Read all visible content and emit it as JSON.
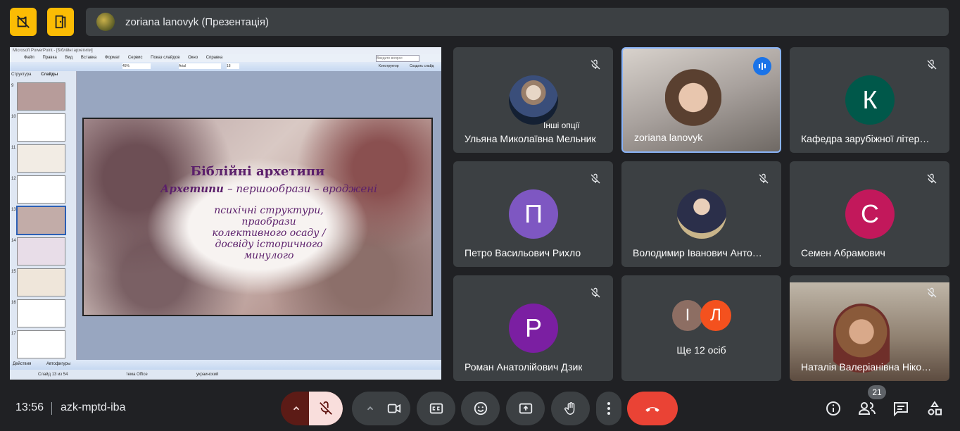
{
  "presenter": {
    "name": "zoriana lanovyk (Презентація)"
  },
  "powerpoint": {
    "title": "Microsoft PowerPoint - [Біблійні архетипи]",
    "menu": [
      "Файл",
      "Правка",
      "Вид",
      "Вставка",
      "Формат",
      "Сервис",
      "Показ слайдов",
      "Окно",
      "Справка"
    ],
    "help_placeholder": "Введите вопрос",
    "zoom": "45%",
    "font": "Arial",
    "font_size": "18",
    "designer": "Конструктор",
    "new_slide": "Создать слайд",
    "tabs": [
      "Структура",
      "Слайды"
    ],
    "thumb_numbers": [
      "9",
      "10",
      "11",
      "12",
      "13",
      "14",
      "15",
      "16",
      "17"
    ],
    "slide": {
      "title": "Біблійні архетипи",
      "term": "Архетипи",
      "body": [
        "– першообрази – вроджені",
        "психічні структури,",
        "праобрази",
        "колективного осаду /",
        "досвіду історичного",
        "минулого"
      ]
    },
    "draw_label": "Действия",
    "autoshapes": "Автофигуры",
    "status": {
      "slide": "Слайд 13 из 54",
      "theme": "тема Office",
      "lang": "украинский"
    }
  },
  "participants": [
    {
      "name": "Ульяна Миколаївна Мельник",
      "more": "Інші опції",
      "muted": true
    },
    {
      "name": "zoriana lanovyk",
      "speaking": true
    },
    {
      "name": "Кафедра зарубіжної літер…",
      "initial": "К",
      "color": "#00584a",
      "muted": true
    },
    {
      "name": "Петро Васильович Рихло",
      "initial": "П",
      "color": "#7e57c2",
      "muted": true
    },
    {
      "name": "Володимир Іванович Анто…",
      "muted": true
    },
    {
      "name": "Семен Абрамович",
      "initial": "С",
      "color": "#c2185b",
      "muted": true
    },
    {
      "name": "Роман Анатолійович Дзик",
      "initial": "Р",
      "color": "#7b1fa2",
      "muted": true
    },
    {
      "others": "Ще 12 осіб",
      "initials": [
        "І",
        "Л"
      ],
      "colors": [
        "#8d6e63",
        "#f4511e"
      ]
    },
    {
      "name": "Наталія Валеріанівна Ніко…",
      "muted": true
    }
  ],
  "bottom": {
    "time": "13:56",
    "meeting_code": "azk-mptd-iba",
    "participant_count": "21"
  },
  "colors": {
    "accent_yellow": "#fbbc04",
    "end_call": "#ea4335",
    "mic_off_bg": "#f9dedc",
    "tile": "#3c4043"
  }
}
